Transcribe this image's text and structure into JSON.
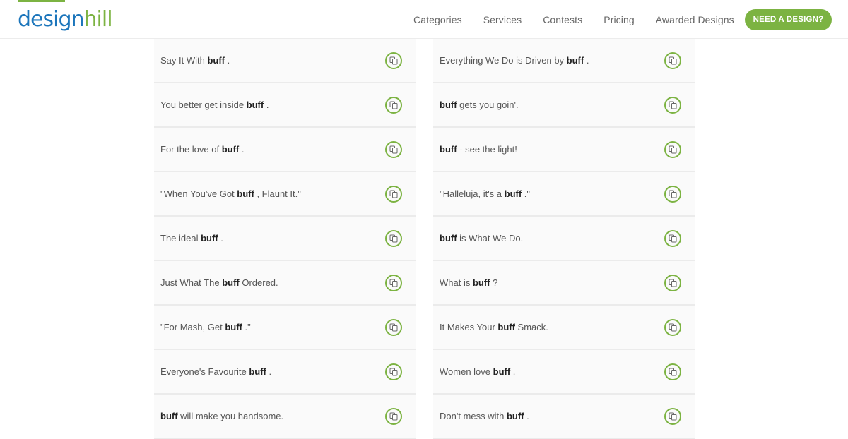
{
  "header": {
    "logo": {
      "part1": "design",
      "part2": "hill"
    },
    "nav": [
      "Categories",
      "Services",
      "Contests",
      "Pricing",
      "Awarded Designs"
    ],
    "cta_label": "NEED A DESIGN?"
  },
  "colors": {
    "brand_blue": "#1b75bb",
    "brand_green": "#7cb342"
  },
  "keyword": "buff",
  "slogans": {
    "left": [
      {
        "before": "Say It With ",
        "keyword": "buff",
        "after": " ."
      },
      {
        "before": "You better get inside ",
        "keyword": "buff",
        "after": " ."
      },
      {
        "before": "For the love of ",
        "keyword": "buff",
        "after": " ."
      },
      {
        "before": "\"When You've Got ",
        "keyword": "buff",
        "after": " , Flaunt It.\""
      },
      {
        "before": "The ideal ",
        "keyword": "buff",
        "after": " ."
      },
      {
        "before": "Just What The ",
        "keyword": "buff",
        "after": " Ordered."
      },
      {
        "before": "\"For Mash, Get ",
        "keyword": "buff",
        "after": " .\""
      },
      {
        "before": "Everyone's Favourite ",
        "keyword": "buff",
        "after": " ."
      },
      {
        "before": "",
        "keyword": "buff",
        "after": " will make you handsome."
      }
    ],
    "right": [
      {
        "before": "Everything We Do is Driven by ",
        "keyword": "buff",
        "after": " ."
      },
      {
        "before": "",
        "keyword": "buff",
        "after": " gets you goin'."
      },
      {
        "before": "",
        "keyword": "buff",
        "after": " - see the light!"
      },
      {
        "before": "\"Halleluja, it's a ",
        "keyword": "buff",
        "after": " .\""
      },
      {
        "before": "",
        "keyword": "buff",
        "after": " is What We Do."
      },
      {
        "before": "What is ",
        "keyword": "buff",
        "after": " ?"
      },
      {
        "before": "It Makes Your ",
        "keyword": "buff",
        "after": " Smack."
      },
      {
        "before": "Women love ",
        "keyword": "buff",
        "after": " ."
      },
      {
        "before": "Don't mess with ",
        "keyword": "buff",
        "after": " ."
      }
    ]
  },
  "icons": {
    "copy": "copy-icon"
  }
}
